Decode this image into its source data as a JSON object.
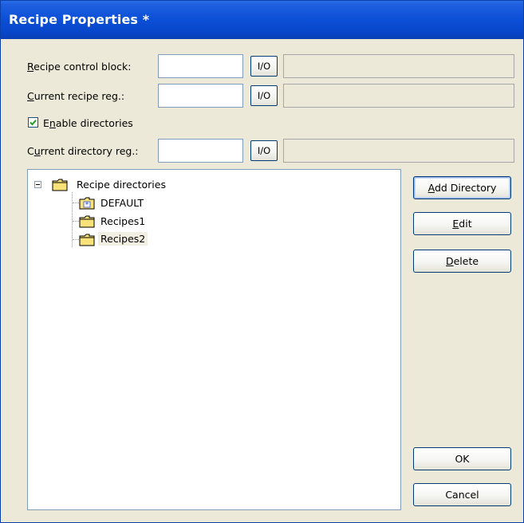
{
  "window": {
    "title": "Recipe Properties *"
  },
  "fields": {
    "control_block": {
      "label_pre": "",
      "label_mn": "R",
      "label_post": "ecipe control block:",
      "value": "",
      "io": "I/O",
      "display": ""
    },
    "current_recipe": {
      "label_pre": "",
      "label_mn": "C",
      "label_post": "urrent recipe reg.:",
      "value": "",
      "io": "I/O",
      "display": ""
    },
    "enable_dirs": {
      "label_pre": "E",
      "label_mn": "n",
      "label_post": "able directories",
      "checked": true
    },
    "current_dir": {
      "label_pre": "C",
      "label_mn": "u",
      "label_post": "rrent directory reg.:",
      "value": "",
      "io": "I/O",
      "display": ""
    }
  },
  "tree": {
    "root": "Recipe directories",
    "children": [
      "DEFAULT",
      "Recipes1",
      "Recipes2"
    ],
    "selected": "Recipes2",
    "default_marker": "*"
  },
  "buttons": {
    "add_dir": {
      "mn": "A",
      "rest": "dd Directory"
    },
    "edit": {
      "mn": "E",
      "rest": "dit"
    },
    "delete": {
      "mn": "D",
      "rest": "elete"
    },
    "ok": "OK",
    "cancel": "Cancel"
  },
  "icons": {
    "checkbox": "checkmark-icon",
    "expander": "minus-box-icon",
    "folder": "folder-icon",
    "default_folder": "folder-star-icon"
  },
  "colors": {
    "titlebar": "#0a4fd6",
    "face": "#ece9d8",
    "folder": "#f9e27a",
    "check": "#21a121"
  }
}
